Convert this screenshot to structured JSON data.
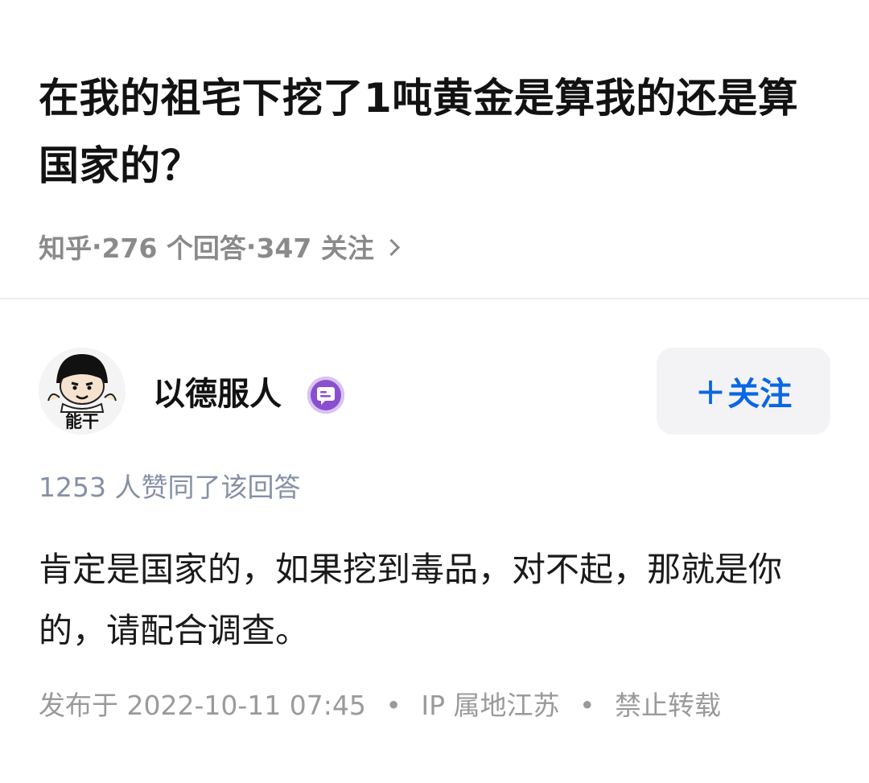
{
  "question": {
    "title": "在我的祖宅下挖了1吨黄金是算我的还是算国家的？",
    "source": "知乎",
    "answer_count": "276 个回答",
    "follow_count": "347 关注",
    "separator": "·"
  },
  "answer": {
    "author": {
      "name": "以德服人",
      "avatar_caption": "能干",
      "badge_icon": "comment-badge-icon"
    },
    "follow_button": {
      "plus": "+",
      "label": "关注"
    },
    "upvote_text": "1253 人赞同了该回答",
    "content": "肯定是国家的，如果挖到毒品，对不起，那就是你的，请配合调查。",
    "footer": {
      "published": "发布于 2022-10-11 07:45",
      "ip_location": "IP 属地江苏",
      "reprint": "禁止转载",
      "separator": "•"
    }
  },
  "colors": {
    "accent": "#0a66e4",
    "meta_gray": "#8a8a8a",
    "upvote_gray": "#8590a6",
    "badge_purple": "#8a4fd1"
  }
}
